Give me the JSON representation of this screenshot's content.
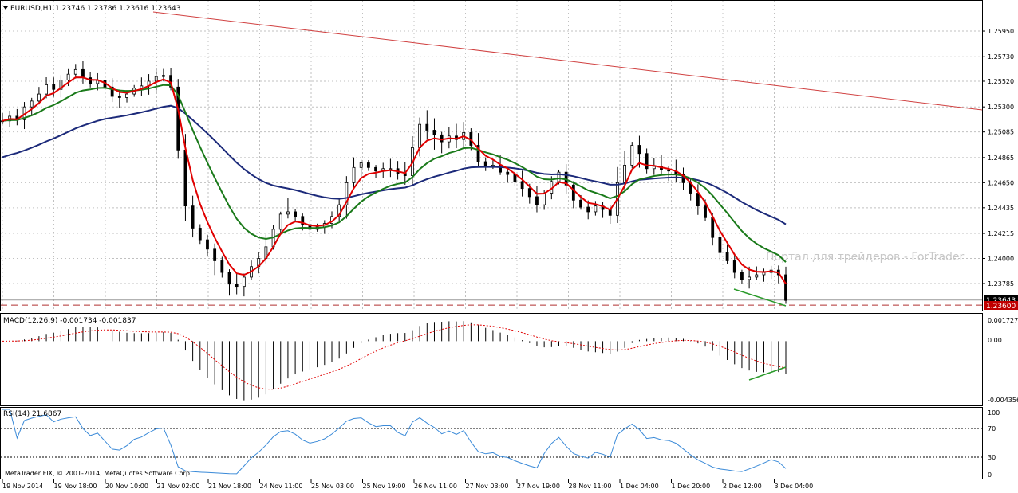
{
  "colors": {
    "background": "#ffffff",
    "grid": "#c0c0c0",
    "candle": "#000000",
    "ema_fast": "#e00000",
    "ema_mid": "#1a7a1a",
    "ema_slow": "#1c2a7a",
    "trendline": "#d04040",
    "support": "#b03030",
    "divergence": "#2a9a2a",
    "macd_signal": "#e00000",
    "rsi": "#3a8ad8",
    "price_tag": "#c00000"
  },
  "main_header": "EURUSD,H1  1.23746 1.23786 1.23616 1.23643",
  "watermark": "Портал для трейдеров - ForTrader",
  "footer_text": "MetaTrader FIX, © 2001-2014, MetaQuotes Software Corp.",
  "macd_header": "MACD(12,26,9) -0.001734 -0.001837",
  "rsi_header": "RSI(14) 21.6867",
  "chart_data": [
    {
      "type": "candlestick",
      "title": "EURUSD,H1",
      "ohlc_last": {
        "open": 1.23746,
        "high": 1.23786,
        "low": 1.23616,
        "close": 1.23643
      },
      "y_ticks": [
        "1.25950",
        "1.25730",
        "1.25520",
        "1.25300",
        "1.25085",
        "1.24865",
        "1.24650",
        "1.24435",
        "1.24215",
        "1.24000",
        "1.23785"
      ],
      "ylim": [
        1.2358,
        1.2608
      ],
      "price_tags": [
        "1.23643",
        "1.23600"
      ],
      "close_series": [
        1.2518,
        1.2522,
        1.2519,
        1.253,
        1.2535,
        1.2541,
        1.2549,
        1.2545,
        1.2553,
        1.2558,
        1.2562,
        1.2555,
        1.255,
        1.2553,
        1.2547,
        1.2539,
        1.2538,
        1.2541,
        1.2546,
        1.2548,
        1.2552,
        1.2556,
        1.2557,
        1.2547,
        1.2493,
        1.2445,
        1.2426,
        1.2416,
        1.2408,
        1.2398,
        1.2388,
        1.2378,
        1.2376,
        1.2384,
        1.2393,
        1.24,
        1.241,
        1.2425,
        1.2438,
        1.244,
        1.2436,
        1.2429,
        1.2425,
        1.2427,
        1.243,
        1.2436,
        1.2446,
        1.2465,
        1.2478,
        1.2482,
        1.2478,
        1.2475,
        1.2477,
        1.2477,
        1.2473,
        1.2471,
        1.2495,
        1.2515,
        1.251,
        1.2506,
        1.25,
        1.2505,
        1.2502,
        1.2508,
        1.2497,
        1.2483,
        1.2479,
        1.248,
        1.2474,
        1.2472,
        1.2466,
        1.246,
        1.2453,
        1.2446,
        1.2456,
        1.2466,
        1.2474,
        1.2463,
        1.245,
        1.2444,
        1.244,
        1.2445,
        1.2442,
        1.2437,
        1.2465,
        1.248,
        1.2497,
        1.249,
        1.2477,
        1.2479,
        1.2476,
        1.2475,
        1.2472,
        1.2465,
        1.2456,
        1.2445,
        1.2435,
        1.2418,
        1.2405,
        1.2398,
        1.2388,
        1.2382,
        1.2384,
        1.2386,
        1.2388,
        1.239,
        1.2386,
        1.2364
      ]
    },
    {
      "type": "bar",
      "title": "MACD(12,26,9)",
      "y_ticks": [
        "0.001727",
        "0.00",
        "-0.004356"
      ],
      "ylim": [
        -0.004356,
        0.001727
      ]
    },
    {
      "type": "line",
      "title": "RSI(14)",
      "y_ticks": [
        "100",
        "70",
        "30",
        "0"
      ],
      "ylim": [
        0,
        100
      ],
      "levels": [
        70,
        30
      ]
    },
    {
      "type": "axis",
      "x_ticks": [
        "19 Nov 2014",
        "19 Nov 18:00",
        "20 Nov 10:00",
        "21 Nov 02:00",
        "21 Nov 18:00",
        "24 Nov 11:00",
        "25 Nov 03:00",
        "25 Nov 19:00",
        "26 Nov 11:00",
        "27 Nov 03:00",
        "27 Nov 19:00",
        "28 Nov 11:00",
        "1 Dec 04:00",
        "1 Dec 20:00",
        "2 Dec 12:00",
        "3 Dec 04:00"
      ]
    }
  ]
}
